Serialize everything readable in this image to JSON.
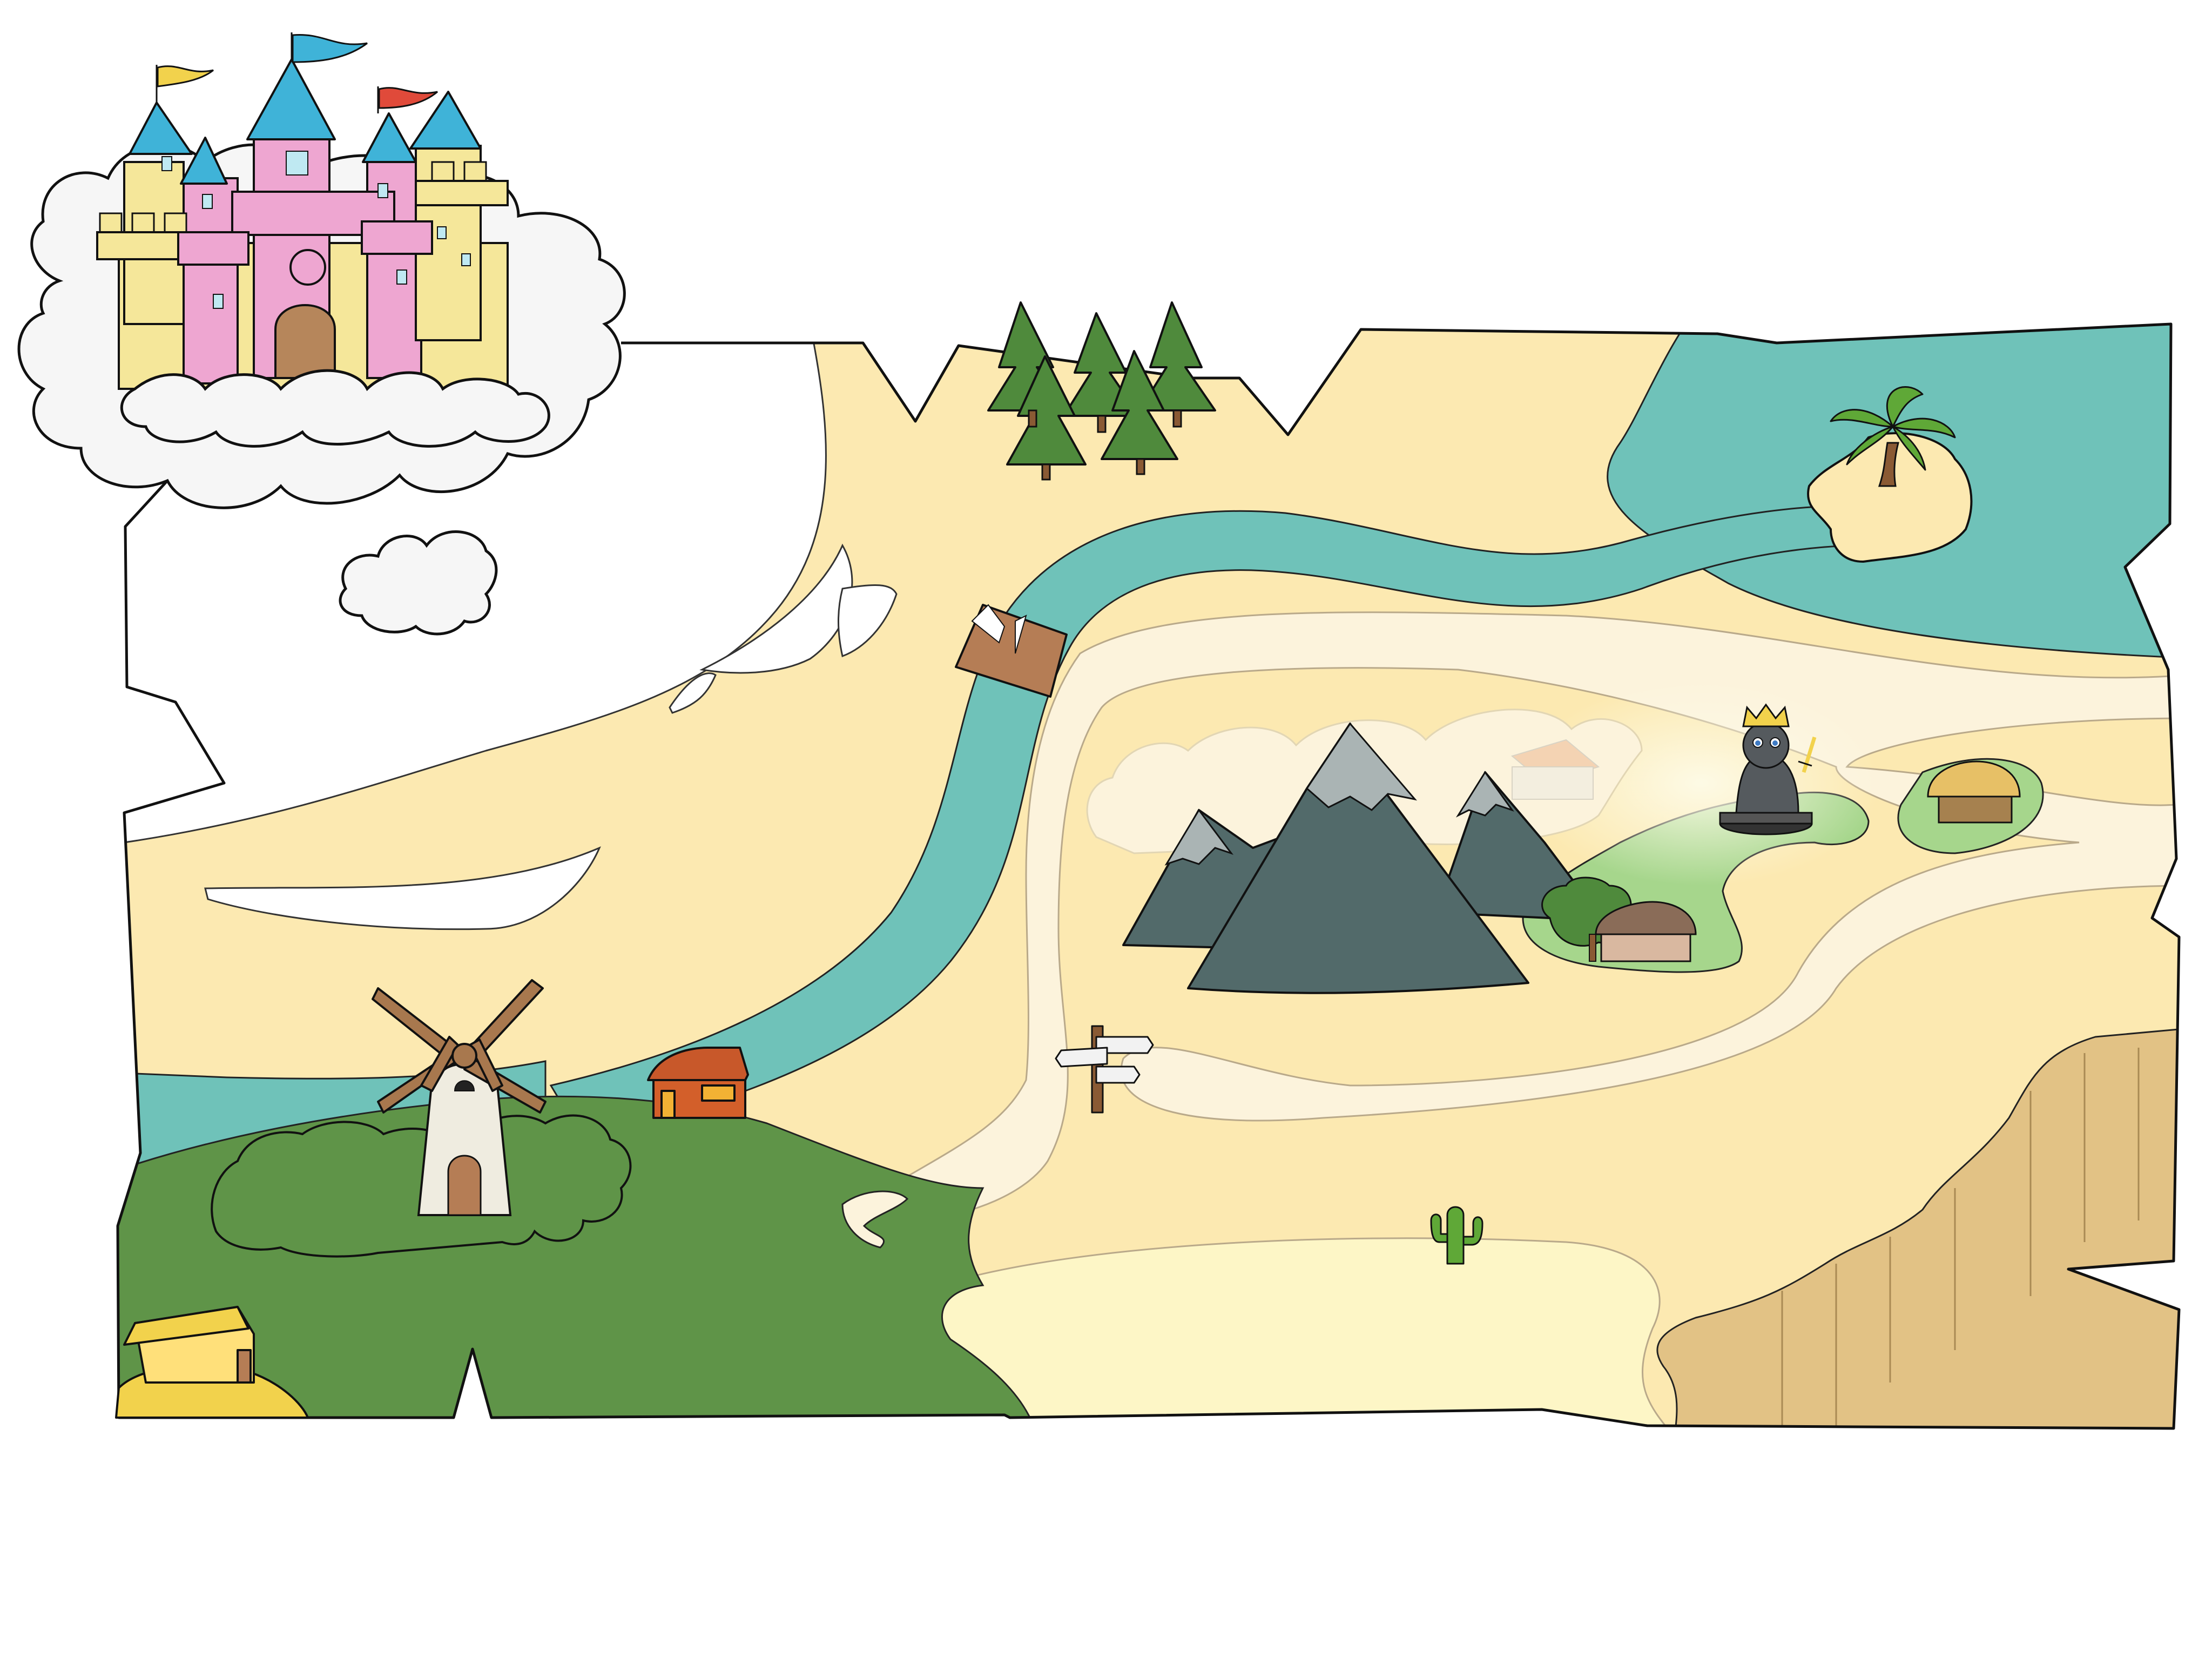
{
  "palette": {
    "background": "#ffffff",
    "parchment": "#fce9b1",
    "path": "#fcf3dc",
    "sea": "#6fc2b9",
    "grass": "#5f9448",
    "meadow": "#a6d68c",
    "desert": "#fdf6c6",
    "cliff": "#e2c285",
    "mountain": "#526a6a",
    "snow": "#aab4b4",
    "outline": "#111111",
    "cloud": "#f6f6f6",
    "tree": "#4f8a3c",
    "trunk": "#8a5a34",
    "castle_wall": "#f5e79a",
    "castle_tower": "#eea6d1",
    "castle_roof": "#3fb3d8",
    "castle_door": "#b6865b",
    "windmill_blade": "#a8784e",
    "windmill_body": "#efece0",
    "hut_roof": "#e7c066",
    "cottage_wall": "#d35f2a",
    "palm": "#5fa837"
  },
  "features": [
    {
      "id": "sky-castle",
      "icon": "castle-icon"
    },
    {
      "id": "pine-forest",
      "icon": "pine-tree-icon"
    },
    {
      "id": "palm-island",
      "icon": "palm-tree-icon"
    },
    {
      "id": "river",
      "icon": "river-icon"
    },
    {
      "id": "mountains",
      "icon": "mountain-icon"
    },
    {
      "id": "king-statue",
      "icon": "crowned-statue-icon"
    },
    {
      "id": "straw-hut",
      "icon": "hut-icon"
    },
    {
      "id": "village-hut",
      "icon": "hut-icon"
    },
    {
      "id": "windmill",
      "icon": "windmill-icon"
    },
    {
      "id": "cottage",
      "icon": "house-icon"
    },
    {
      "id": "farmhouse",
      "icon": "barn-icon"
    },
    {
      "id": "signpost",
      "icon": "signpost-icon"
    },
    {
      "id": "cactus",
      "icon": "cactus-icon"
    },
    {
      "id": "cliffs",
      "icon": "cliff-icon"
    },
    {
      "id": "wooden-bridge",
      "icon": "bridge-icon"
    }
  ]
}
